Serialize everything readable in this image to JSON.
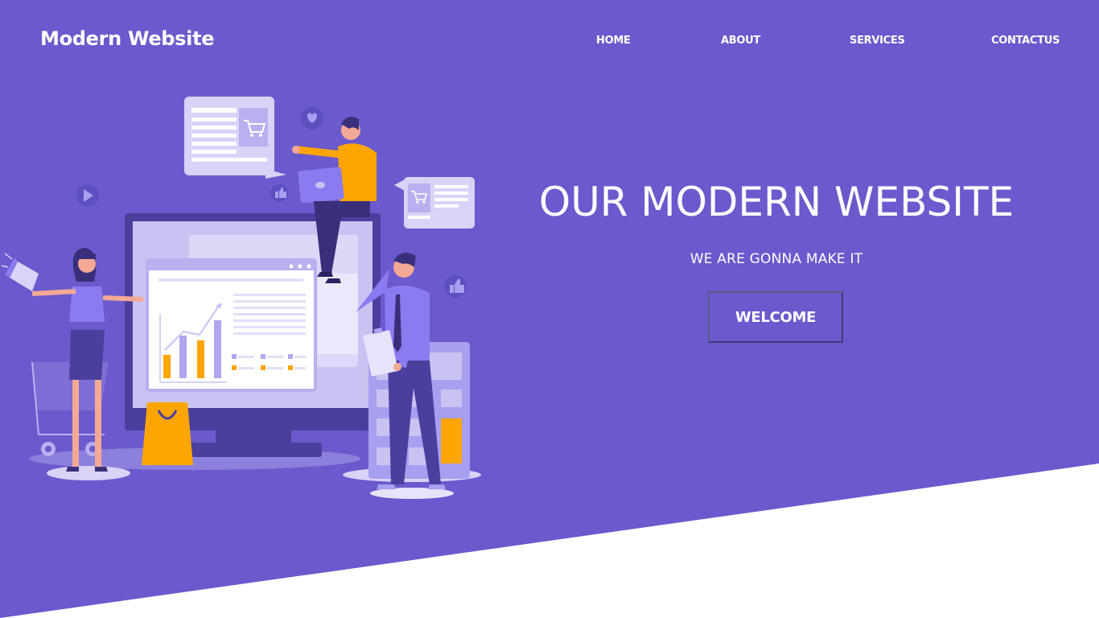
{
  "brand": {
    "name": "Modern Website"
  },
  "nav": {
    "home": "HOME",
    "about": "ABOUT",
    "services": "SERVICES",
    "contact": "CONTACTUS"
  },
  "hero": {
    "title": "OUR MODERN WEBSITE",
    "subtitle": "WE ARE GONNA MAKE IT",
    "cta_label": "WELCOME"
  },
  "colors": {
    "hero_background": "#6a5acd",
    "accent_orange": "#ffa500",
    "illustration_light": "#c9c3f2",
    "illustration_dark": "#4b3f9e"
  },
  "illustration": {
    "icons": [
      "cart-icon",
      "heart-icon",
      "play-icon",
      "thumbs-up-icon",
      "megaphone-icon",
      "shopping-bag-icon",
      "calculator-icon",
      "shopping-cart-icon"
    ],
    "chart_bar_levels": [
      0.3,
      0.55,
      0.5,
      0.7
    ]
  }
}
